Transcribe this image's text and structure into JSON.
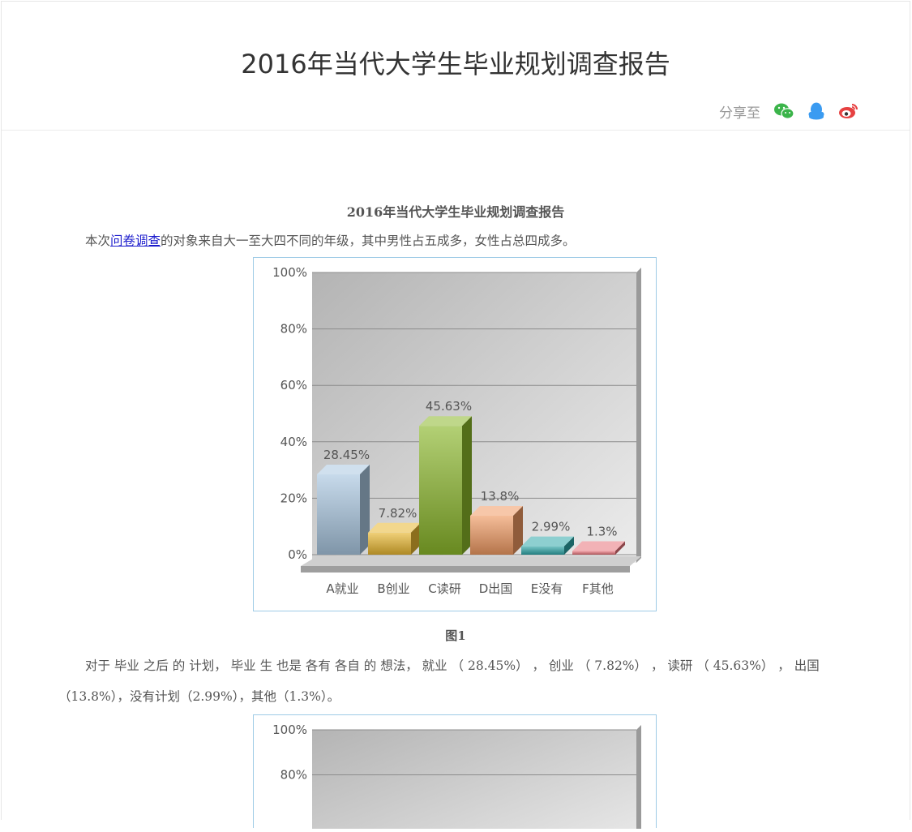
{
  "header": {
    "title": "2016年当代大学生毕业规划调查报告",
    "share_label": "分享至",
    "share_icons": [
      "wechat-icon",
      "qq-icon",
      "weibo-icon"
    ],
    "colors": {
      "wechat": "#3bb44a",
      "qq": "#3a9bf1",
      "weibo": "#e64141"
    }
  },
  "article": {
    "title": "2016年当代大学生毕业规划调查报告",
    "intro_prefix": "本次",
    "intro_link": "问卷调查",
    "intro_suffix": "的对象来自大一至大四不同的年级，其中男性占五成多，女性占总四成多。",
    "figure1_caption": "图1",
    "para2_line1": "对于 毕业 之后 的 计划， 毕业 生 也是 各有 各自 的 想法， 就业 （ 28.45%） ， 创业 （ 7.82%） ， 读研 （ 45.63%） ， 出国",
    "para2_line2": "（13.8%），没有计划（2.99%），其他（1.3%）。"
  },
  "chart_data": [
    {
      "type": "bar",
      "categories": [
        "A就业",
        "B创业",
        "C读研",
        "D出国",
        "E没有",
        "F其他"
      ],
      "values": [
        28.45,
        7.82,
        45.63,
        13.8,
        2.99,
        1.3
      ],
      "value_labels": [
        "28.45%",
        "7.82%",
        "45.63%",
        "13.8%",
        "2.99%",
        "1.3%"
      ],
      "ylim": [
        0,
        100
      ],
      "yticks": [
        "0%",
        "20%",
        "40%",
        "60%",
        "80%",
        "100%"
      ],
      "colors": [
        "#a9c6e0",
        "#e8b730",
        "#8ab72a",
        "#f09a62",
        "#2fa7a9",
        "#e8737a"
      ],
      "grid": true
    },
    {
      "type": "bar",
      "yticks": [
        "100%",
        "80%"
      ],
      "ylim": [
        0,
        100
      ],
      "grid": true
    }
  ]
}
